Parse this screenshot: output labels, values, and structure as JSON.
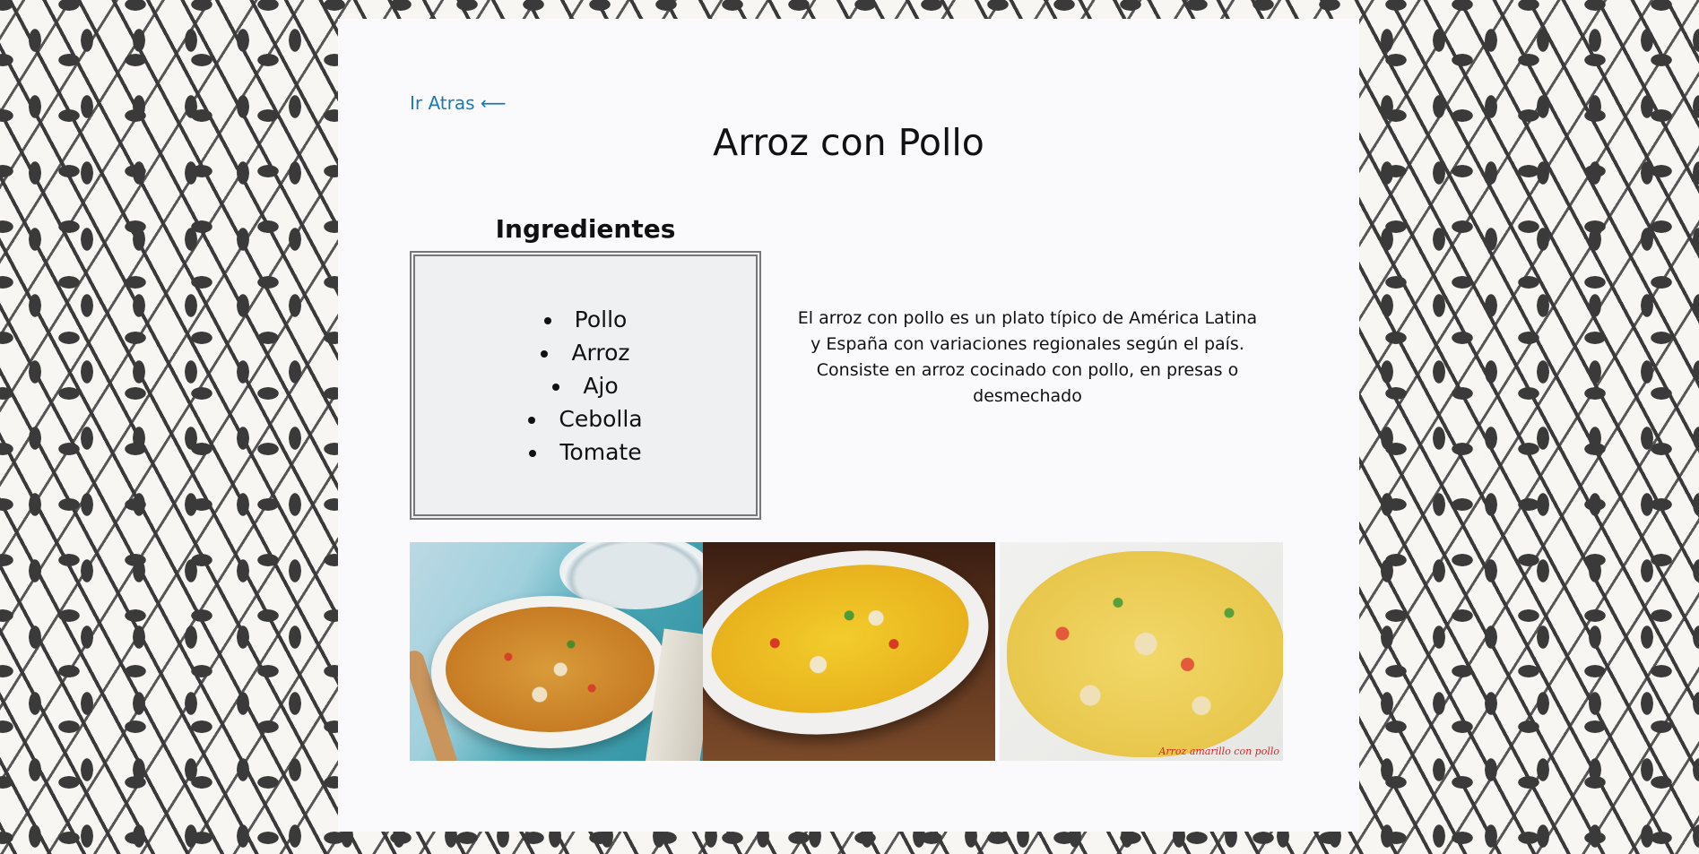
{
  "nav": {
    "back_label": "Ir Atras ⟵"
  },
  "recipe": {
    "title": "Arroz con Pollo",
    "ingredients_heading": "Ingredientes",
    "ingredients": [
      "Pollo",
      "Arroz",
      "Ajo",
      "Cebolla",
      "Tomate"
    ],
    "description": "El arroz con pollo es un plato típico de América Latina y España con variaciones regionales según el país. Consiste en arroz cocinado con pollo, en presas o desmechado"
  },
  "photos": [
    {
      "name": "arroz-con-pollo-platter"
    },
    {
      "name": "arroz-con-pollo-bowl"
    },
    {
      "name": "arroz-amarillo-plate",
      "caption": "Arroz amarillo con pollo"
    }
  ],
  "colors": {
    "link": "#1a7ab8",
    "panel_bg": "#fafafc",
    "ingredients_box_bg": "#eff0f2",
    "ingredients_border": "#777777"
  }
}
